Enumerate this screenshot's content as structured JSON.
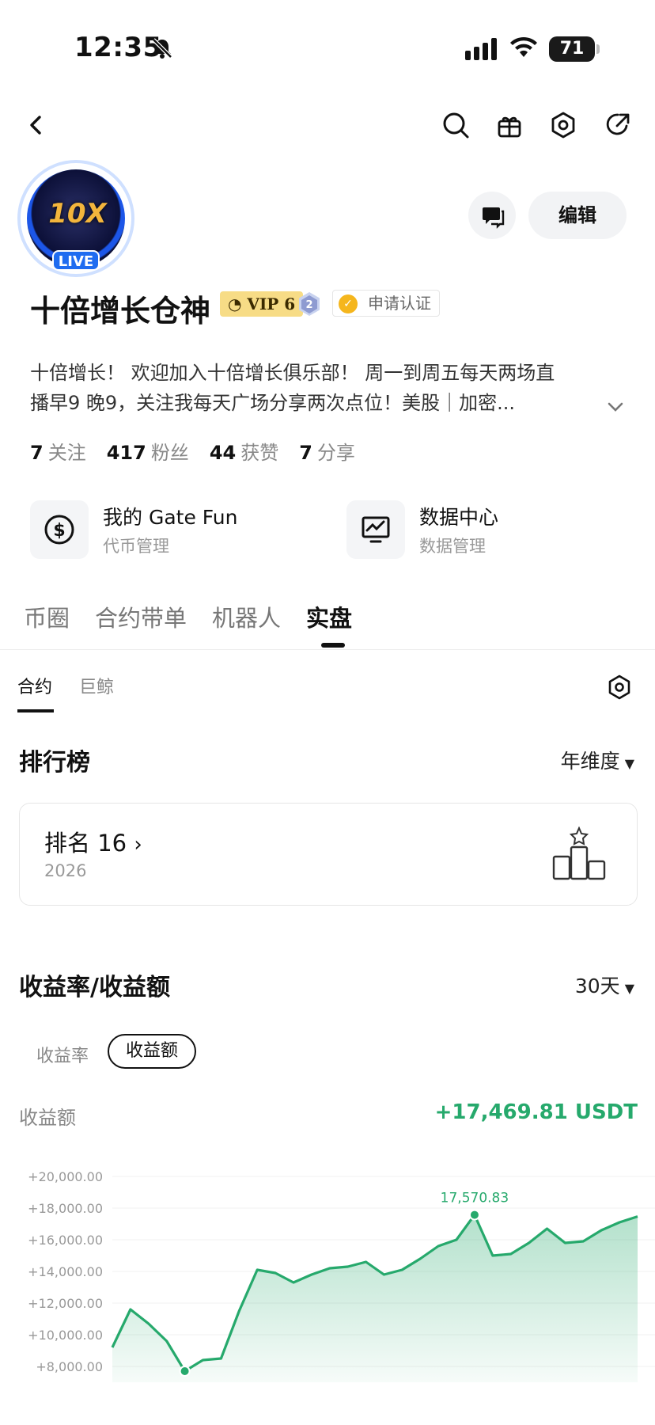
{
  "status_bar": {
    "time": "12:35",
    "battery": "71"
  },
  "profile": {
    "live_label": "LIVE",
    "avatar_text": "10X",
    "edit_label": "编辑",
    "name": "十倍增长仓神",
    "vip_label": "VIP 6",
    "level": "2",
    "verify_label": "申请认证",
    "bio_line1": "十倍增长！ 欢迎加入十倍增长俱乐部！ 周一到周五每天两场直",
    "bio_line2": "播早9 晚9，关注我每天广场分享两次点位！美股｜加密...",
    "stats": [
      {
        "num": "7",
        "label": "关注"
      },
      {
        "num": "417",
        "label": "粉丝"
      },
      {
        "num": "44",
        "label": "获赞"
      },
      {
        "num": "7",
        "label": "分享"
      }
    ]
  },
  "tools": [
    {
      "title": "我的 Gate Fun",
      "subtitle": "代币管理",
      "icon": "dollar-circle-icon"
    },
    {
      "title": "数据中心",
      "subtitle": "数据管理",
      "icon": "chart-monitor-icon"
    }
  ],
  "tabs": [
    "币圈",
    "合约带单",
    "机器人",
    "实盘"
  ],
  "subtabs": [
    "合约",
    "巨鲸"
  ],
  "ranking": {
    "title": "排行榜",
    "period": "年维度",
    "rank_label": "排名 16",
    "year": "2026"
  },
  "returns": {
    "title": "收益率/收益额",
    "period": "30天",
    "toggle_rate": "收益率",
    "toggle_amount": "收益额",
    "metric_label": "收益额",
    "metric_value": "+17,469.81 USDT",
    "peak_label": "17,570.83"
  },
  "chart_data": {
    "type": "area",
    "y_ticks": [
      "+20,000.00",
      "+18,000.00",
      "+16,000.00",
      "+14,000.00",
      "+12,000.00",
      "+10,000.00",
      "+8,000.00"
    ],
    "ylim": [
      7000,
      20800
    ],
    "values": [
      9200,
      11600,
      10700,
      9600,
      7700,
      8400,
      8500,
      11500,
      14100,
      13900,
      13300,
      13800,
      14200,
      14300,
      14600,
      13800,
      14100,
      14800,
      15600,
      16000,
      17570.83,
      15000,
      15100,
      15800,
      16700,
      15800,
      15900,
      16600,
      17100,
      17470
    ],
    "color": "#26a96c",
    "peak_value": 17570.83,
    "low_value": 7700
  }
}
